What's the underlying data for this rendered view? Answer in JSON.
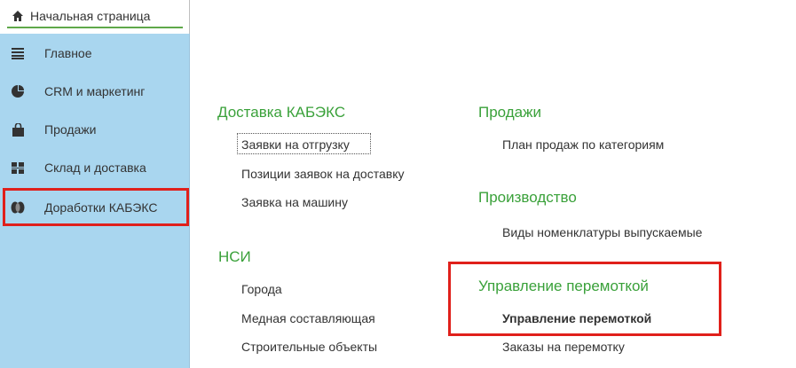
{
  "home_tab": {
    "icon": "home-icon",
    "label": "Начальная страница"
  },
  "sidebar": {
    "items": [
      {
        "icon": "menu-lines-icon",
        "label": "Главное"
      },
      {
        "icon": "pie-chart-icon",
        "label": "CRM и маркетинг"
      },
      {
        "icon": "shopping-bag-icon",
        "label": "Продажи"
      },
      {
        "icon": "warehouse-grid-icon",
        "label": "Склад и доставка"
      },
      {
        "icon": "cable-reel-icon",
        "label": "Доработки КАБЭКС"
      }
    ],
    "selected": "Доработки КАБЭКС"
  },
  "main": {
    "groups": [
      {
        "title": "Доставка КАБЭКС",
        "links": [
          "Заявки на отгрузку",
          "Позиции заявок на доставку",
          "Заявка на машину"
        ]
      },
      {
        "title": "НСИ",
        "links": [
          "Города",
          "Медная составляющая",
          "Строительные объекты"
        ]
      },
      {
        "title": "Продажи",
        "links": [
          "План продаж по категориям"
        ]
      },
      {
        "title": "Производство",
        "links": [
          "Виды номенклатуры выпускаемые"
        ]
      },
      {
        "title": "Управление перемоткой",
        "links": [
          "Управление перемоткой",
          "Заказы на перемотку"
        ]
      }
    ]
  },
  "colors": {
    "sidebar_bg": "#a9d6ef",
    "group_title": "#3aa13a",
    "highlight": "#e0201b",
    "tab_underline": "#5fa84a"
  }
}
